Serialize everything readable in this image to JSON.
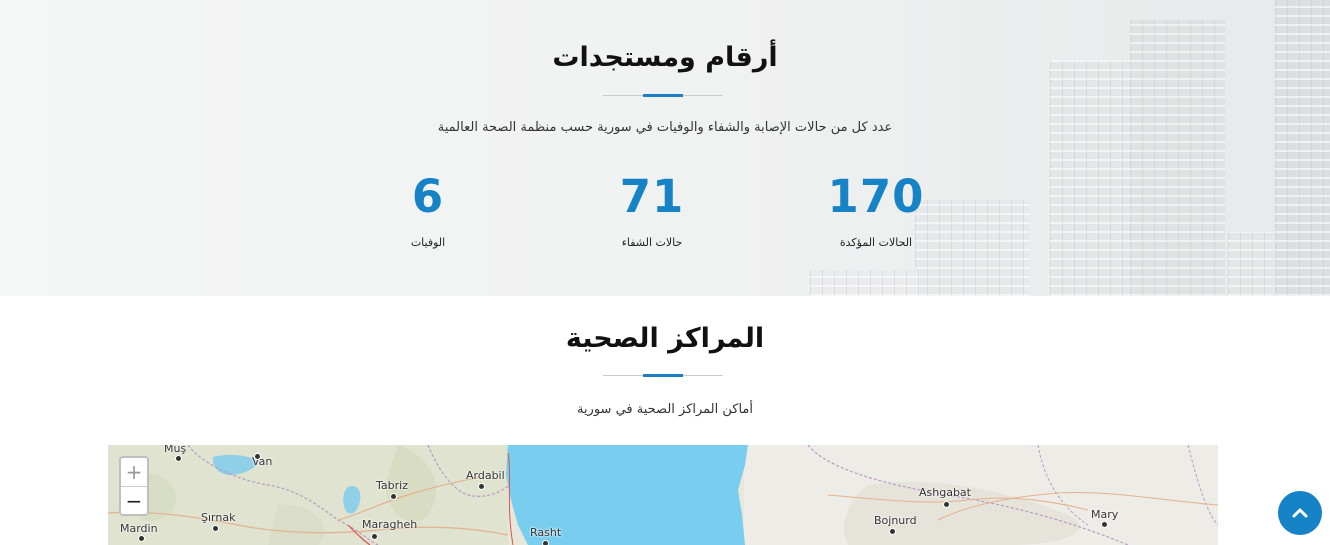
{
  "stats_section": {
    "title": "أرقام ومستجدات",
    "description": "عدد كل من حالات الإصابة والشفاء والوفيات في سورية حسب منظمة الصحة العالمية",
    "items": [
      {
        "value": "170",
        "label": "الحالات المؤكدة"
      },
      {
        "value": "71",
        "label": "حالات الشفاء"
      },
      {
        "value": "6",
        "label": "الوفيات"
      }
    ]
  },
  "centers_section": {
    "title": "المراكز الصحية",
    "description": "أماكن المراكز الصحية في سورية"
  },
  "map": {
    "zoom_in_label": "+",
    "zoom_out_label": "−",
    "cities": [
      "Muş",
      "Van",
      "Tabriz",
      "Ardabil",
      "Mardin",
      "Şırnak",
      "Maragheh",
      "Rasht",
      "Ashgabat",
      "Bojnurd",
      "Mary"
    ]
  },
  "back_to_top": {
    "icon": "chevron-up-icon"
  },
  "colors": {
    "accent": "#1683c6",
    "title_rule_accent": "#1a7fc4",
    "sea": "#79cdef"
  }
}
